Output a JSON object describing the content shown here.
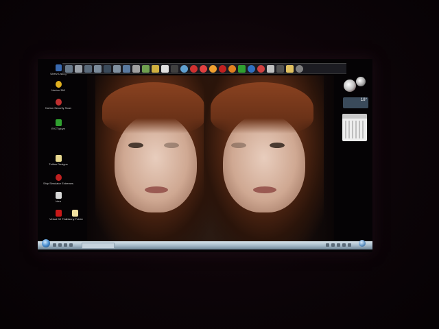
{
  "desktop": {
    "icons": [
      {
        "name": "uberz-icon",
        "label": "Uberz Listing",
        "color": "#3a6ab0"
      },
      {
        "name": "norton-icon",
        "label": "Norton 360",
        "color": "#e0b020"
      },
      {
        "name": "security-scan-icon",
        "label": "Norton Security Scan",
        "color": "#c03030"
      },
      {
        "name": "spotify-icon",
        "label": "BYZTgloyn",
        "color": "#30a030"
      },
      {
        "name": "folder-icon",
        "label": "Tuition Designs",
        "color": "#e8d890"
      },
      {
        "name": "ship-simulator-icon",
        "label": "Ship Simulator Extremes",
        "color": "#c02020"
      },
      {
        "name": "document-icon",
        "label": "Idea",
        "color": "#d8d8d8"
      },
      {
        "name": "virtual-dj-icon",
        "label": "Virtual DJ Trial",
        "color": "#c81818"
      },
      {
        "name": "new-folder-icon",
        "label": "Nanny Folder",
        "color": "#f0e0a0"
      }
    ]
  },
  "toolbar": {
    "icons": [
      {
        "name": "app-icon-1",
        "color": "#6a7a8a"
      },
      {
        "name": "app-icon-2",
        "color": "#9aa0a8"
      },
      {
        "name": "app-icon-3",
        "color": "#5a6a7a"
      },
      {
        "name": "app-icon-4",
        "color": "#7a8a9a"
      },
      {
        "name": "app-icon-5",
        "color": "#3a4a5a"
      },
      {
        "name": "app-icon-6",
        "color": "#8090a0"
      },
      {
        "name": "app-icon-7",
        "color": "#5a7aa0"
      },
      {
        "name": "app-icon-8",
        "color": "#a0a0a0"
      },
      {
        "name": "app-icon-9",
        "color": "#70a050"
      },
      {
        "name": "app-icon-10",
        "color": "#d0b040"
      },
      {
        "name": "app-icon-11",
        "color": "#e0e0e0"
      },
      {
        "name": "app-icon-12",
        "color": "#404040"
      },
      {
        "name": "app-icon-13",
        "color": "#60a0d0"
      },
      {
        "name": "app-icon-14",
        "color": "#d03030"
      },
      {
        "name": "app-icon-15",
        "color": "#e04040"
      },
      {
        "name": "app-icon-16",
        "color": "#f0a030"
      },
      {
        "name": "app-icon-17",
        "color": "#c02020"
      },
      {
        "name": "app-icon-18",
        "color": "#e08020"
      },
      {
        "name": "app-icon-19",
        "color": "#30a030"
      },
      {
        "name": "app-icon-20",
        "color": "#3070c0"
      },
      {
        "name": "app-icon-21",
        "color": "#d04040"
      },
      {
        "name": "app-icon-22",
        "color": "#c0c0c0"
      },
      {
        "name": "app-icon-23",
        "color": "#505050"
      },
      {
        "name": "app-icon-24",
        "color": "#e0c060"
      },
      {
        "name": "app-icon-25",
        "color": "#808080"
      }
    ]
  },
  "gadgets": {
    "weather_temp": "18°",
    "calendar_color": "#eeeeee"
  }
}
